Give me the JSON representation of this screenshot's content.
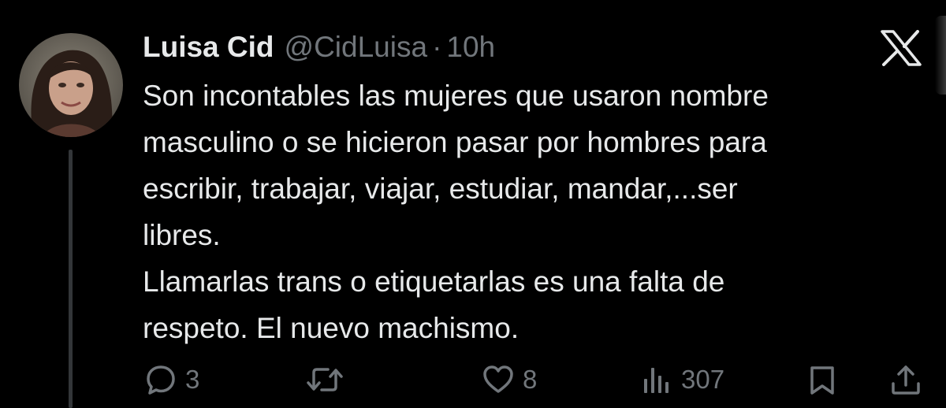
{
  "tweet": {
    "author": {
      "display_name": "Luisa Cid",
      "handle": "@CidLuisa",
      "separator": "·",
      "time": "10h"
    },
    "text_lines": [
      "Son incontables las mujeres que usaron nombre",
      "masculino o se hicieron pasar por hombres para",
      "escribir, trabajar, viajar, estudiar, mandar,...ser",
      "libres.",
      "Llamarlas trans o etiquetarlas es una falta de",
      "respeto. El nuevo machismo."
    ],
    "actions": {
      "reply": {
        "icon": "reply-icon",
        "count": "3"
      },
      "retweet": {
        "icon": "retweet-icon",
        "count": ""
      },
      "like": {
        "icon": "heart-icon",
        "count": "8"
      },
      "views": {
        "icon": "views-bar-chart-icon",
        "count": "307"
      },
      "bookmark": {
        "icon": "bookmark-icon"
      },
      "share": {
        "icon": "share-icon"
      }
    }
  },
  "brand": {
    "icon": "x-logo-icon"
  },
  "colors": {
    "background": "#000000",
    "primary_text": "#e7e9ea",
    "secondary_text": "#71767b",
    "thread_line": "#333639"
  }
}
